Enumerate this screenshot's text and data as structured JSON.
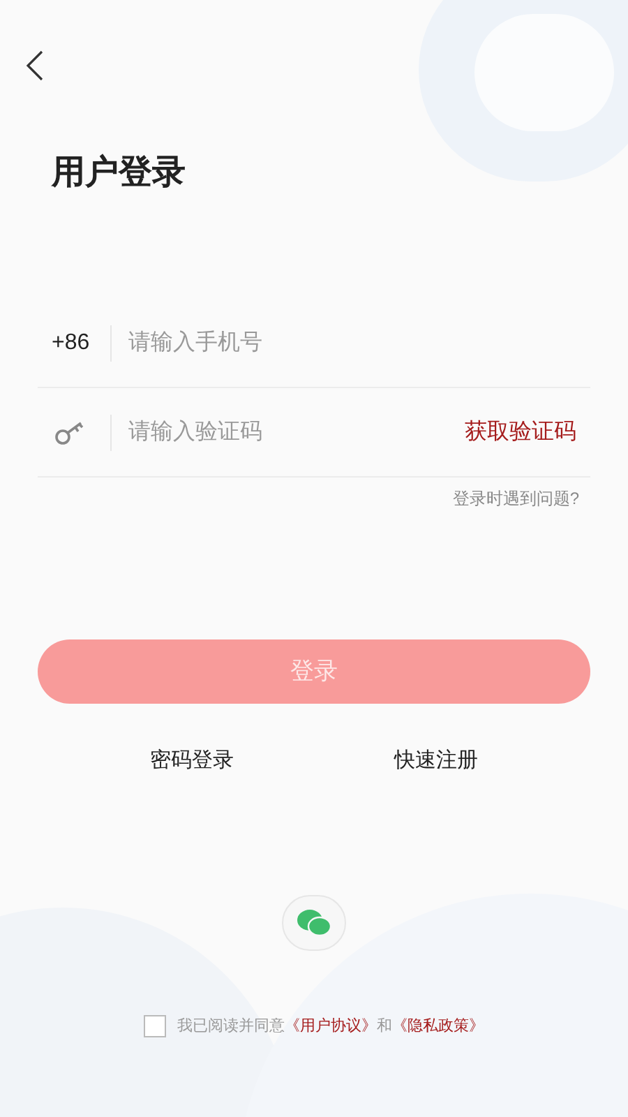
{
  "title": "用户登录",
  "phone": {
    "prefix": "+86",
    "placeholder": "请输入手机号"
  },
  "code": {
    "placeholder": "请输入验证码",
    "action": "获取验证码"
  },
  "help_link": "登录时遇到问题?",
  "login_button": {
    "label": "登录",
    "disabled": true
  },
  "alt_links": [
    "密码登录",
    "快速注册"
  ],
  "agreement": {
    "checked": false,
    "parts": [
      {
        "kind": "text",
        "text": "我已阅读并同意"
      },
      {
        "kind": "link",
        "text": "《用户协议》"
      },
      {
        "kind": "text",
        "text": "和"
      },
      {
        "kind": "link",
        "text": "《隐私政策》"
      }
    ]
  }
}
